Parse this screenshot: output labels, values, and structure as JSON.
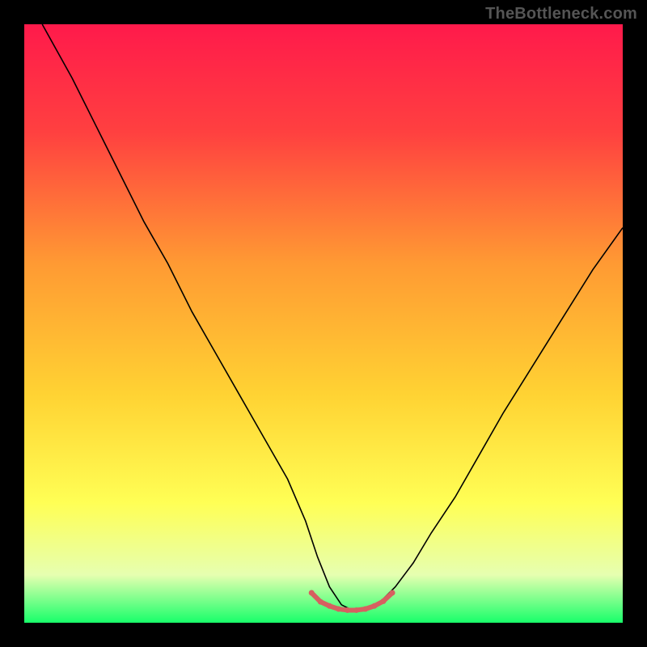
{
  "watermark": "TheBottleneck.com",
  "chart_data": {
    "type": "line",
    "title": "",
    "xlabel": "",
    "ylabel": "",
    "xlim": [
      0,
      100
    ],
    "ylim": [
      0,
      100
    ],
    "grid": false,
    "legend": false,
    "background_gradient": {
      "stops": [
        {
          "offset": 0.0,
          "color": "#ff1a4b"
        },
        {
          "offset": 0.18,
          "color": "#ff4040"
        },
        {
          "offset": 0.4,
          "color": "#ff9a33"
        },
        {
          "offset": 0.62,
          "color": "#ffd333"
        },
        {
          "offset": 0.8,
          "color": "#ffff55"
        },
        {
          "offset": 0.92,
          "color": "#e6ffb0"
        },
        {
          "offset": 1.0,
          "color": "#18ff6a"
        }
      ]
    },
    "series": [
      {
        "name": "curve",
        "stroke": "#000000",
        "stroke_width": 1.6,
        "x": [
          3,
          8,
          12,
          16,
          20,
          24,
          28,
          32,
          36,
          40,
          44,
          47,
          49,
          51,
          53,
          55,
          57,
          59,
          62,
          65,
          68,
          72,
          76,
          80,
          85,
          90,
          95,
          100
        ],
        "y": [
          100,
          91,
          83,
          75,
          67,
          60,
          52,
          45,
          38,
          31,
          24,
          17,
          11,
          6,
          3,
          2,
          2,
          3,
          6,
          10,
          15,
          21,
          28,
          35,
          43,
          51,
          59,
          66
        ]
      },
      {
        "name": "trough-marker",
        "stroke": "#d66060",
        "stroke_width": 6,
        "linecap": "round",
        "x": [
          48,
          49.5,
          51,
          52.5,
          54,
          55.5,
          57,
          58.5,
          60,
          61.5
        ],
        "y": [
          5.0,
          3.5,
          2.8,
          2.3,
          2.1,
          2.1,
          2.3,
          2.8,
          3.6,
          5.0
        ]
      }
    ]
  }
}
